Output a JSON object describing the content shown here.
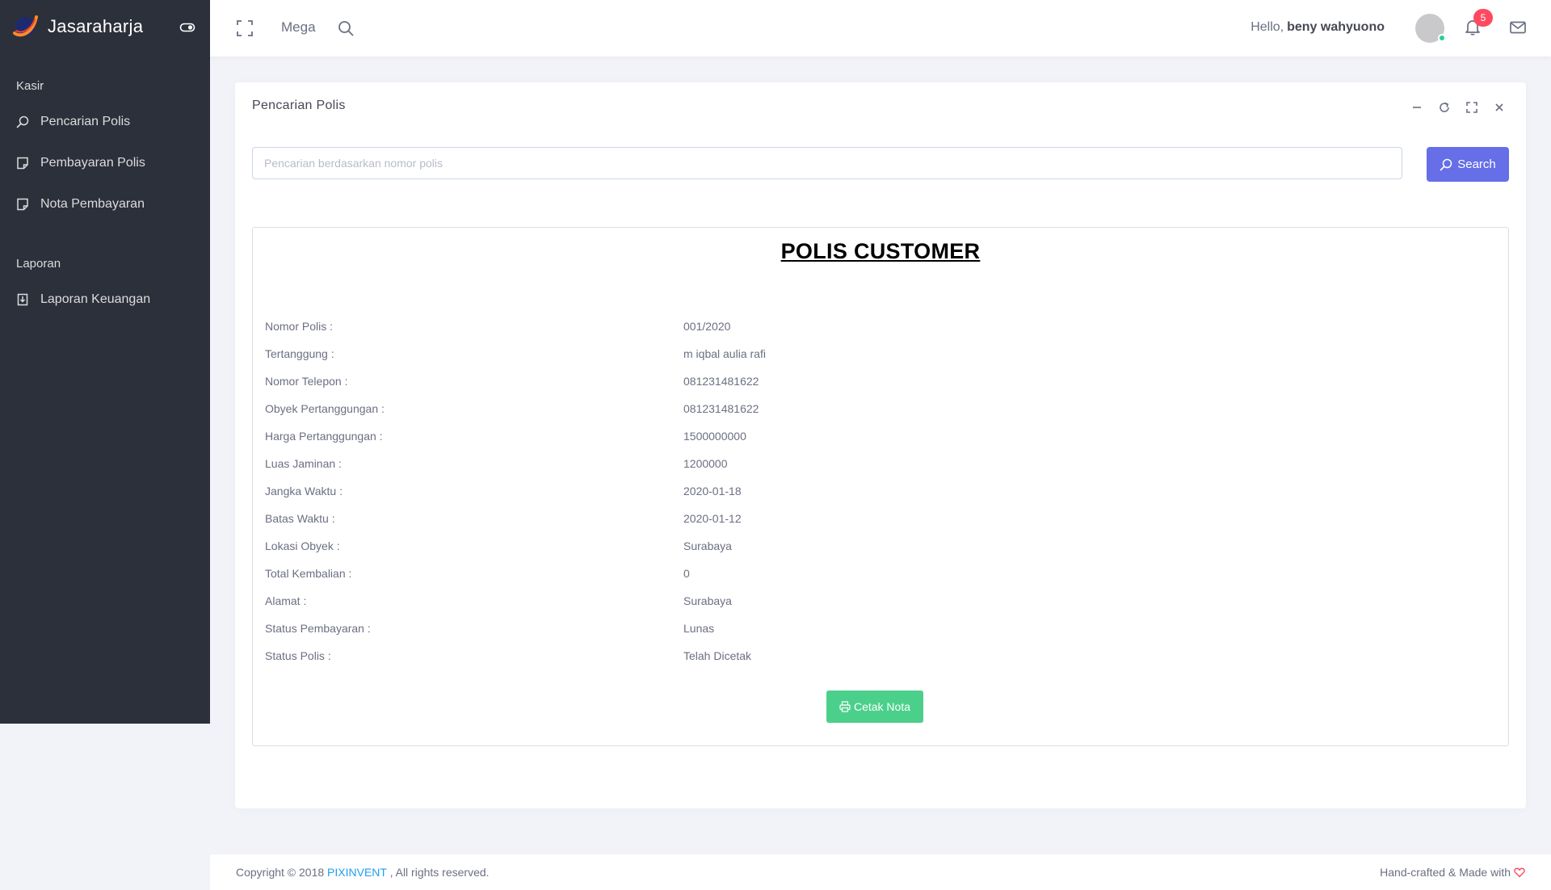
{
  "brand": {
    "name": "Jasaraharja"
  },
  "sidebar": {
    "sections": [
      {
        "header": "Kasir",
        "items": [
          {
            "label": "Pencarian Polis",
            "icon": "search-icon"
          },
          {
            "label": "Pembayaran Polis",
            "icon": "note-icon"
          },
          {
            "label": "Nota Pembayaran",
            "icon": "note-icon"
          }
        ]
      },
      {
        "header": "Laporan",
        "items": [
          {
            "label": "Laporan Keuangan",
            "icon": "download-file-icon"
          }
        ]
      }
    ]
  },
  "navbar": {
    "mega_label": "Mega",
    "greeting": "Hello,",
    "user_name": "beny wahyuono",
    "notification_count": "5"
  },
  "card": {
    "title": "Pencarian Polis",
    "search_placeholder": "Pencarian berdasarkan nomor polis",
    "search_value": "",
    "search_button": "Search"
  },
  "polis": {
    "heading": "POLIS CUSTOMER",
    "fields": [
      {
        "label": "Nomor Polis :",
        "value": "001/2020"
      },
      {
        "label": "Tertanggung :",
        "value": "m iqbal aulia rafi"
      },
      {
        "label": "Nomor Telepon :",
        "value": "081231481622"
      },
      {
        "label": "Obyek Pertanggungan :",
        "value": "081231481622"
      },
      {
        "label": "Harga Pertanggungan :",
        "value": "1500000000"
      },
      {
        "label": "Luas Jaminan :",
        "value": "1200000"
      },
      {
        "label": "Jangka Waktu :",
        "value": "2020-01-18"
      },
      {
        "label": "Batas Waktu :",
        "value": "2020-01-12"
      },
      {
        "label": "Lokasi Obyek :",
        "value": "Surabaya"
      },
      {
        "label": "Total Kembalian :",
        "value": "0"
      },
      {
        "label": "Alamat :",
        "value": "Surabaya"
      },
      {
        "label": "Status Pembayaran :",
        "value": "Lunas"
      },
      {
        "label": "Status Polis :",
        "value": "Telah Dicetak"
      }
    ],
    "print_button": "Cetak Nota"
  },
  "footer": {
    "copyright_prefix": "Copyright © 2018",
    "company": "PIXINVENT",
    "copyright_suffix": ", All rights reserved.",
    "made_with": "Hand-crafted & Made with"
  },
  "colors": {
    "sidebar_bg": "#2c303b",
    "primary": "#666ee8",
    "success": "#4bd08b",
    "badge": "#ff4961",
    "link": "#1e9ff2"
  }
}
